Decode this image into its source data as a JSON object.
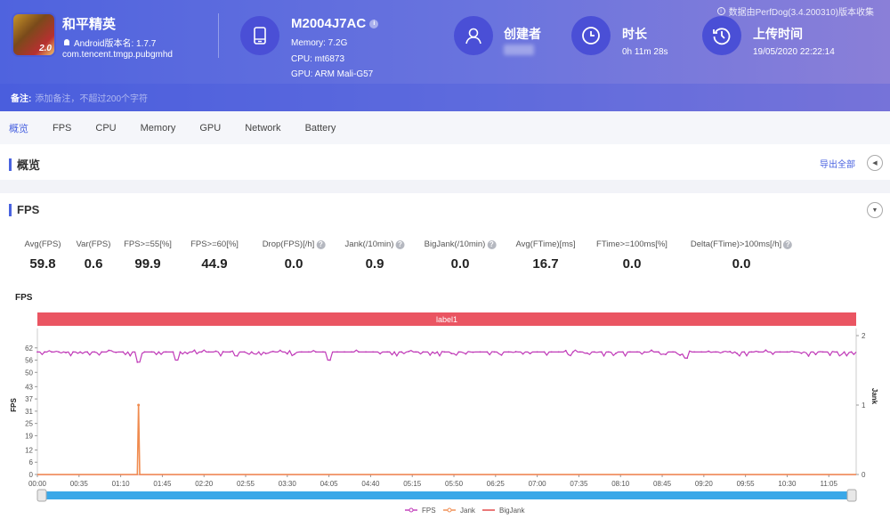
{
  "header": {
    "app": {
      "title": "和平精英",
      "icon_badge": "2.0",
      "version_label": "Android版本名: 1.7.7",
      "package": "com.tencent.tmgp.pubgmhd",
      "platform_icon": "android-icon"
    },
    "device": {
      "model": "M2004J7AC",
      "memory": "Memory: 7.2G",
      "cpu": "CPU: mt6873",
      "gpu": "GPU: ARM Mali-G57",
      "icon": "tablet-icon"
    },
    "creator": {
      "title": "创建者",
      "icon": "user-icon"
    },
    "duration": {
      "title": "时长",
      "value": "0h 11m 28s",
      "icon": "clock-icon"
    },
    "upload": {
      "title": "上传时间",
      "value": "19/05/2020 22:22:14",
      "icon": "history-icon"
    },
    "credit": "数据由PerfDog(3.4.200310)版本收集",
    "note": {
      "label": "备注:",
      "placeholder": "添加备注，不超过200个字符"
    }
  },
  "tabs": [
    {
      "label": "概览",
      "active": true
    },
    {
      "label": "FPS"
    },
    {
      "label": "CPU"
    },
    {
      "label": "Memory"
    },
    {
      "label": "GPU"
    },
    {
      "label": "Network"
    },
    {
      "label": "Battery"
    }
  ],
  "overview": {
    "title": "概览",
    "export_label": "导出全部"
  },
  "fps_section": {
    "title": "FPS",
    "metrics": [
      {
        "label": "Avg(FPS)",
        "value": "59.8",
        "help": false
      },
      {
        "label": "Var(FPS)",
        "value": "0.6",
        "help": false
      },
      {
        "label": "FPS>=55[%]",
        "value": "99.9",
        "help": false
      },
      {
        "label": "FPS>=60[%]",
        "value": "44.9",
        "help": false
      },
      {
        "label": "Drop(FPS)[/h]",
        "value": "0.0",
        "help": true
      },
      {
        "label": "Jank(/10min)",
        "value": "0.9",
        "help": true
      },
      {
        "label": "BigJank(/10min)",
        "value": "0.0",
        "help": true
      },
      {
        "label": "Avg(FTime)[ms]",
        "value": "16.7",
        "help": false
      },
      {
        "label": "FTime>=100ms[%]",
        "value": "0.0",
        "help": false
      },
      {
        "label": "Delta(FTime)>100ms[/h]",
        "value": "0.0",
        "help": true
      }
    ],
    "help_glyph": "?"
  },
  "chart_data": {
    "type": "line",
    "title": "FPS",
    "label_band": "label1",
    "xlabel": "",
    "ylabel": "FPS",
    "y2label": "Jank",
    "x_ticks": [
      "00:00",
      "00:35",
      "01:10",
      "01:45",
      "02:20",
      "02:55",
      "03:30",
      "04:05",
      "04:40",
      "05:15",
      "05:50",
      "06:25",
      "07:00",
      "07:35",
      "08:10",
      "08:45",
      "09:20",
      "09:55",
      "10:30",
      "11:05"
    ],
    "x_range_seconds": [
      0,
      688
    ],
    "y_ticks": [
      0,
      6,
      12,
      19,
      25,
      31,
      37,
      43,
      50,
      56,
      62
    ],
    "ylim": [
      0,
      68
    ],
    "y2_ticks": [
      0,
      1,
      2
    ],
    "y2lim": [
      0,
      2
    ],
    "grid": false,
    "legend_position": "bottom-right",
    "series": [
      {
        "name": "FPS",
        "axis": "left",
        "color": "#c03ab8",
        "baseline": 60,
        "typical_range": [
          58,
          61
        ],
        "dips": [
          {
            "t": 85,
            "value": 55
          },
          {
            "t": 117,
            "value": 56
          },
          {
            "t": 245,
            "value": 56
          },
          {
            "t": 545,
            "value": 57
          }
        ]
      },
      {
        "name": "Jank",
        "axis": "right",
        "color": "#f08c50",
        "baseline": 0,
        "spikes": [
          {
            "t": 85,
            "value": 1
          }
        ]
      },
      {
        "name": "BigJank",
        "axis": "right",
        "color": "#e04040",
        "baseline": 0,
        "spikes": []
      }
    ]
  },
  "colors": {
    "accent": "#4a63e0",
    "label_band": "#ea5562",
    "scrollbar": "#3aa8e8"
  }
}
